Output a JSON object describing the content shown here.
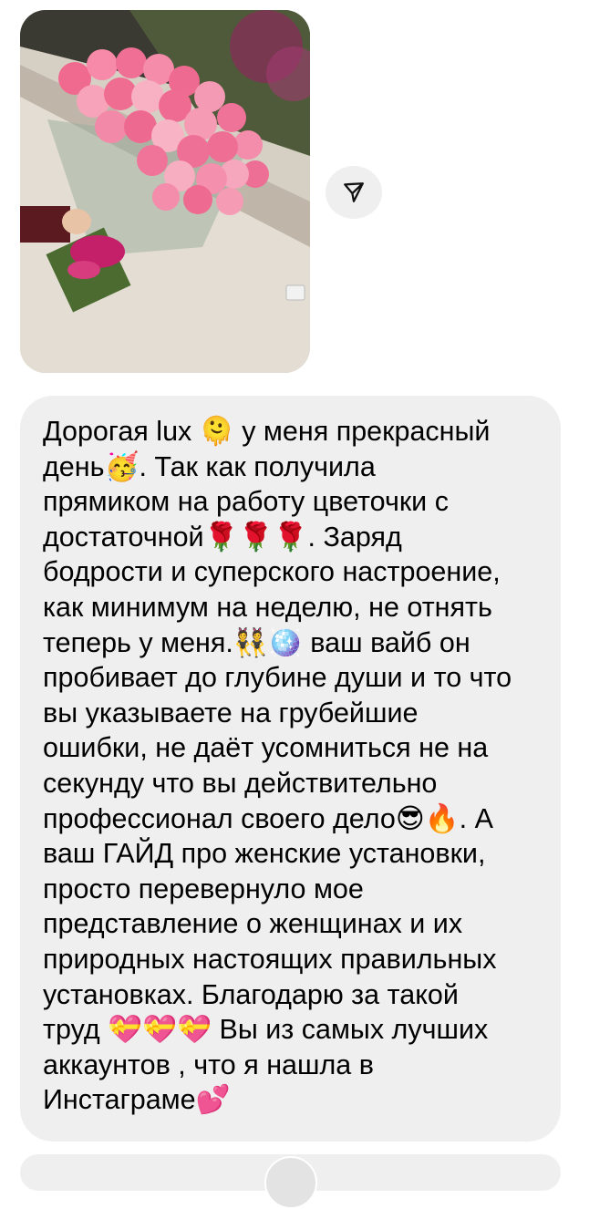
{
  "media": {
    "icon": "rose-bouquet-photo"
  },
  "share_button": {
    "icon": "send-icon"
  },
  "message": {
    "text": "Дорогая lux 🫠 у меня прекрасный\nдень🥳. Так как получила\nпрямиком на работу цветочки с\nдостаточной🌹🌹🌹.  Заряд\nбодрости и суперского настроение,\nкак минимум на неделю,  не отнять\nтеперь у меня.👯🪩 ваш вайб он\nпробивает до глубине души и то что\nвы указываете на грубейшие\nошибки, не даёт усомниться не на\nсекунду что вы действительно\nпрофессионал своего дело😎🔥. А\nваш ГАЙД про женские установки,\nпросто перевернуло мое\nпредставление о женщинах и их\nприродных настоящих правильных\nустановках. Благодарю за такой\nтруд 💝💝💝 Вы из самых лучших\nаккаунтов , что я нашла в\nИнстаграме💕"
  },
  "colors": {
    "bubble_bg": "#efefef",
    "button_bg": "#efefef",
    "text": "#000000"
  }
}
